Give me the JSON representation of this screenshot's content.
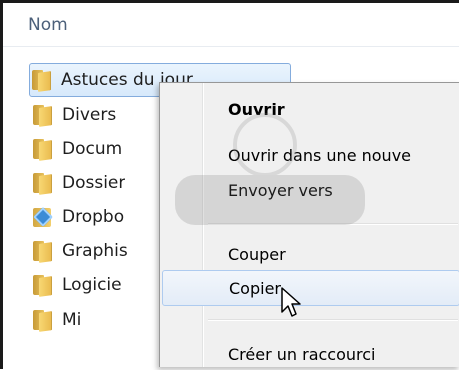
{
  "explorer": {
    "column_header": "Nom",
    "files": [
      {
        "label": "Astuces du jour",
        "icon": "folder-icon",
        "selected": true
      },
      {
        "label": "Divers",
        "icon": "folder-icon"
      },
      {
        "label": "Docum",
        "icon": "folder-icon"
      },
      {
        "label": "Dossier",
        "icon": "folder-icon"
      },
      {
        "label": "Dropbo",
        "icon": "dropbox-folder-icon"
      },
      {
        "label": "Graphis",
        "icon": "folder-icon"
      },
      {
        "label": "Logicie",
        "icon": "folder-icon"
      },
      {
        "label": "Mi",
        "icon": "folder-icon"
      }
    ]
  },
  "context_menu": {
    "items": [
      {
        "label": "Ouvrir",
        "bold": true
      },
      {
        "label": "Ouvrir dans une nouve"
      },
      {
        "label": "Envoyer vers"
      },
      {
        "label": "Couper"
      },
      {
        "label": "Copier",
        "hover": true
      },
      {
        "label": "Créer un raccourci"
      }
    ]
  },
  "colors": {
    "selection_border": "#84acdd",
    "menu_background": "#f0f0f0",
    "hover_border": "#aecbef",
    "header_text": "#4c607a"
  }
}
